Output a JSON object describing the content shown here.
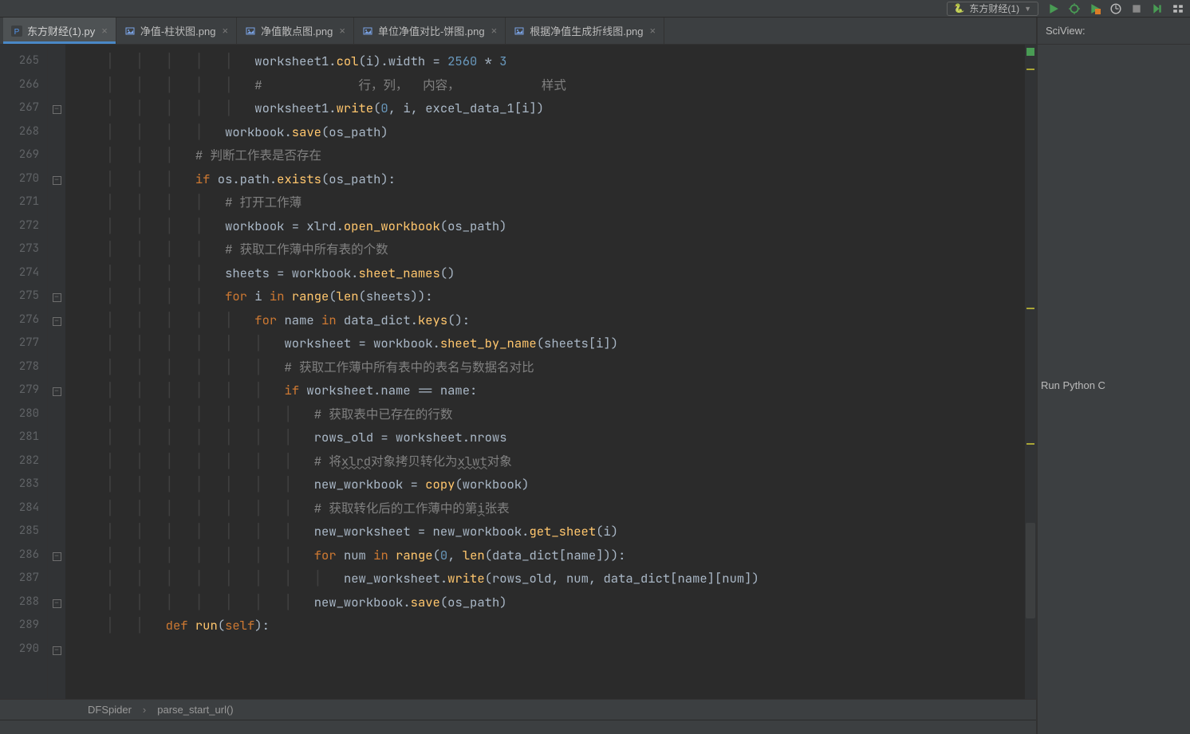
{
  "topbar": {
    "run_config_label": "东方财经(1)"
  },
  "tabs": [
    {
      "label": "东方财经(1).py",
      "icon": "py",
      "active": true
    },
    {
      "label": "净值-柱状图.png",
      "icon": "png",
      "active": false
    },
    {
      "label": "净值散点图.png",
      "icon": "png",
      "active": false
    },
    {
      "label": "单位净值对比-饼图.png",
      "icon": "png",
      "active": false
    },
    {
      "label": "根据净值生成折线图.png",
      "icon": "png",
      "active": false
    }
  ],
  "line_numbers": [
    "265",
    "266",
    "267",
    "268",
    "269",
    "270",
    "271",
    "272",
    "273",
    "274",
    "275",
    "276",
    "277",
    "278",
    "279",
    "280",
    "281",
    "282",
    "283",
    "284",
    "285",
    "286",
    "287",
    "288",
    "289",
    "290"
  ],
  "fold_marks": {
    "267": "minus",
    "270": "minus",
    "275": "minus",
    "276": "minus",
    "279": "minus",
    "286": "minus",
    "288": "minus",
    "290": "minus"
  },
  "code_lines": [
    {
      "n": 265,
      "indent": 24,
      "html": "worksheet1.<span class='fn'>col</span>(i).width = <span class='num'>2560</span> * <span class='num'>3</span>"
    },
    {
      "n": 266,
      "indent": 24,
      "html": "<span class='cm'>#             行，列，  内容，           样式</span>"
    },
    {
      "n": 267,
      "indent": 24,
      "html": "worksheet1.<span class='fn'>write</span>(<span class='num'>0</span>, i, excel_data_1[i])"
    },
    {
      "n": 268,
      "indent": 20,
      "html": "workbook.<span class='fn'>save</span>(os_path)"
    },
    {
      "n": 269,
      "indent": 16,
      "html": "<span class='cm'># 判断工作表是否存在</span>"
    },
    {
      "n": 270,
      "indent": 16,
      "html": "<span class='kw'>if</span> os.path.<span class='fn'>exists</span>(os_path):"
    },
    {
      "n": 271,
      "indent": 20,
      "html": "<span class='cm'># 打开工作薄</span>"
    },
    {
      "n": 272,
      "indent": 20,
      "html": "workbook = xlrd.<span class='fn'>open_workbook</span>(os_path)"
    },
    {
      "n": 273,
      "indent": 20,
      "html": "<span class='cm'># 获取工作薄中所有表的个数</span>"
    },
    {
      "n": 274,
      "indent": 20,
      "html": "sheets = workbook.<span class='fn'>sheet_names</span>()"
    },
    {
      "n": 275,
      "indent": 20,
      "html": "<span class='kw'>for</span> i <span class='kw'>in</span> <span class='fn'>range</span>(<span class='fn'>len</span>(sheets)):"
    },
    {
      "n": 276,
      "indent": 24,
      "html": "<span class='kw'>for</span> name <span class='kw'>in</span> data_dict.<span class='fn'>keys</span>():"
    },
    {
      "n": 277,
      "indent": 28,
      "html": "worksheet = workbook.<span class='fn'>sheet_by_name</span>(sheets[i])"
    },
    {
      "n": 278,
      "indent": 28,
      "html": "<span class='cm'># 获取工作薄中所有表中的表名与数据名对比</span>"
    },
    {
      "n": 279,
      "indent": 28,
      "html": "<span class='kw'>if</span> worksheet.name == name:"
    },
    {
      "n": 280,
      "indent": 32,
      "html": "<span class='cm'># 获取表中已存在的行数</span>"
    },
    {
      "n": 281,
      "indent": 32,
      "html": "rows_old = worksheet.nrows"
    },
    {
      "n": 282,
      "indent": 32,
      "html": "<span class='cm'># 将<span class='wavy'>xlrd</span>对象拷贝转化为<span class='wavy'>xlwt</span>对象</span>"
    },
    {
      "n": 283,
      "indent": 32,
      "html": "new_workbook = <span class='fn'>copy</span>(workbook)"
    },
    {
      "n": 284,
      "indent": 32,
      "html": "<span class='cm'># 获取转化后的工作薄中的第<span class='wavy'>i</span>张表</span>"
    },
    {
      "n": 285,
      "indent": 32,
      "html": "new_worksheet = new_workbook.<span class='fn'>get_sheet</span>(i)"
    },
    {
      "n": 286,
      "indent": 32,
      "html": "<span class='kw'>for</span> num <span class='kw'>in</span> <span class='fn'>range</span>(<span class='num'>0</span>, <span class='fn'>len</span>(data_dict[name])):"
    },
    {
      "n": 287,
      "indent": 36,
      "html": "new_worksheet.<span class='fn'>write</span>(rows_old, num, data_dict[name][num])"
    },
    {
      "n": 288,
      "indent": 32,
      "html": "new_workbook.<span class='fn'>save</span>(os_path)"
    },
    {
      "n": 289,
      "indent": 0,
      "html": ""
    },
    {
      "n": 290,
      "indent": 12,
      "html": "<span class='kw'>def</span> <span class='fn'>run</span>(<span class='self'>self</span>):"
    }
  ],
  "breadcrumbs": [
    "DFSpider",
    "parse_start_url()"
  ],
  "sciview": {
    "title": "SciView:",
    "run_link": "Run Python C"
  }
}
